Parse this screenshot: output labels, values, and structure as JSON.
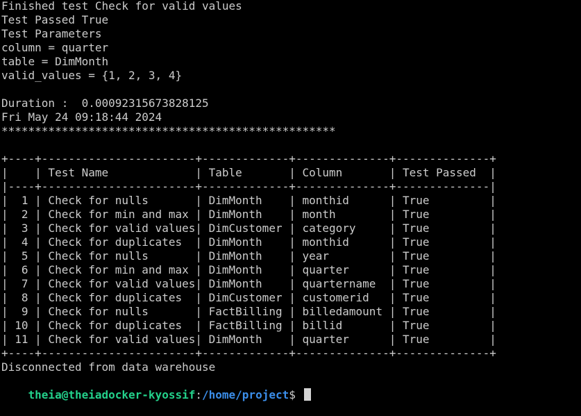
{
  "output_lines": [
    "Finished test Check for valid values",
    "Test Passed True",
    "Test Parameters",
    "column = quarter",
    "table = DimMonth",
    "valid_values = {1, 2, 3, 4}",
    "",
    "Duration :  0.00092315673828125",
    "Fri May 24 09:18:44 2024",
    "**************************************************",
    "",
    "+----+-----------------------+-------------+--------------+--------------+",
    "|    | Test Name             | Table       | Column       | Test Passed  |",
    "|----+-----------------------+-------------+--------------+--------------|",
    "|  1 | Check for nulls       | DimMonth    | monthid      | True         |",
    "|  2 | Check for min and max | DimMonth    | month        | True         |",
    "|  3 | Check for valid values| DimCustomer | category     | True         |",
    "|  4 | Check for duplicates  | DimMonth    | monthid      | True         |",
    "|  5 | Check for nulls       | DimMonth    | year         | True         |",
    "|  6 | Check for min and max | DimMonth    | quarter      | True         |",
    "|  7 | Check for valid values| DimMonth    | quartername  | True         |",
    "|  8 | Check for duplicates  | DimCustomer | customerid   | True         |",
    "|  9 | Check for nulls       | FactBilling | billedamount | True         |",
    "| 10 | Check for duplicates  | FactBilling | billid       | True         |",
    "| 11 | Check for valid values| DimMonth    | quarter      | True         |",
    "+----+-----------------------+-------------+--------------+--------------+",
    "Disconnected from data warehouse"
  ],
  "prompt": {
    "user_host": "theia@theiadocker-kyossif",
    "separator": ":",
    "path": "/home/project",
    "symbol": "$ "
  }
}
